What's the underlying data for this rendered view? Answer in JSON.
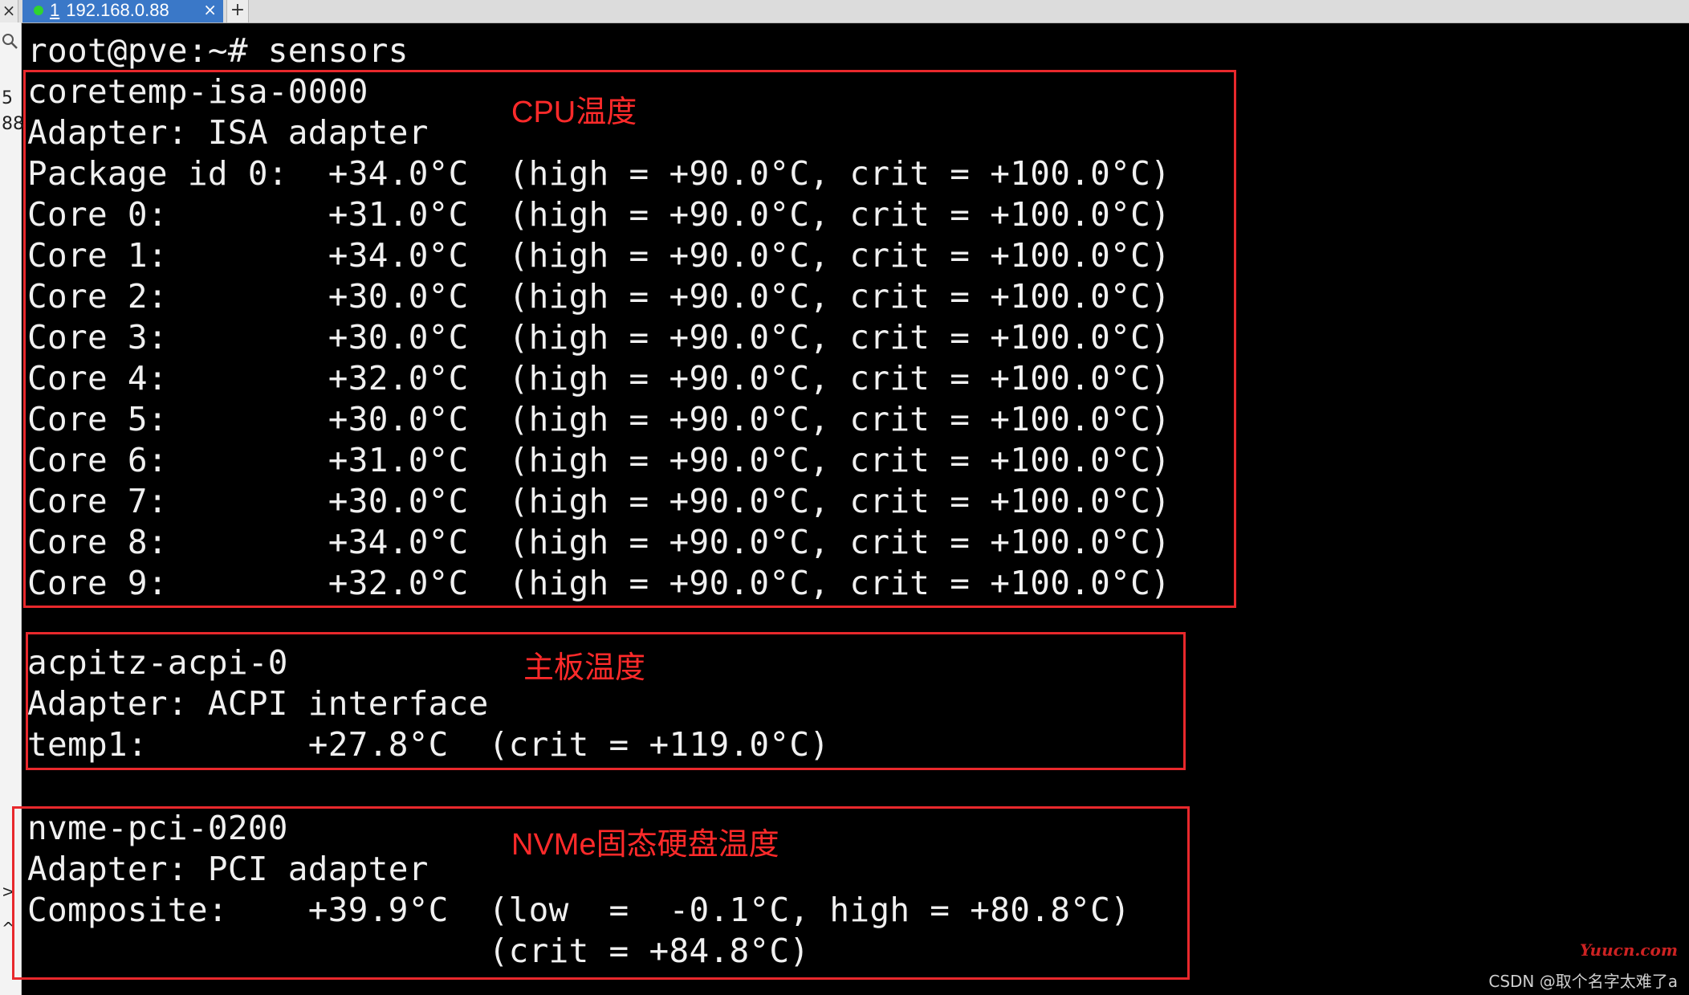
{
  "tabbar": {
    "close_all": "×",
    "active_tab": {
      "index": "1",
      "title": "192.168.0.88",
      "close": "×",
      "status_color": "#2fd42f"
    },
    "new_tab": "+"
  },
  "left_strip": [
    "5",
    "88",
    ">",
    "^"
  ],
  "terminal": {
    "lines": [
      "root@pve:~# sensors",
      "coretemp-isa-0000",
      "Adapter: ISA adapter",
      "Package id 0:  +34.0°C  (high = +90.0°C, crit = +100.0°C)",
      "Core 0:        +31.0°C  (high = +90.0°C, crit = +100.0°C)",
      "Core 1:        +34.0°C  (high = +90.0°C, crit = +100.0°C)",
      "Core 2:        +30.0°C  (high = +90.0°C, crit = +100.0°C)",
      "Core 3:        +30.0°C  (high = +90.0°C, crit = +100.0°C)",
      "Core 4:        +32.0°C  (high = +90.0°C, crit = +100.0°C)",
      "Core 5:        +30.0°C  (high = +90.0°C, crit = +100.0°C)",
      "Core 6:        +31.0°C  (high = +90.0°C, crit = +100.0°C)",
      "Core 7:        +30.0°C  (high = +90.0°C, crit = +100.0°C)",
      "Core 8:        +34.0°C  (high = +90.0°C, crit = +100.0°C)",
      "Core 9:        +32.0°C  (high = +90.0°C, crit = +100.0°C)",
      "",
      "acpitz-acpi-0",
      "Adapter: ACPI interface",
      "temp1:        +27.8°C  (crit = +119.0°C)",
      "",
      "nvme-pci-0200",
      "Adapter: PCI adapter",
      "Composite:    +39.9°C  (low  =  -0.1°C, high = +80.8°C)",
      "                       (crit = +84.8°C)"
    ]
  },
  "annotations": {
    "cpu": "CPU温度",
    "motherboard": "主板温度",
    "nvme": "NVMe固态硬盘温度"
  },
  "colors": {
    "annotation": "#e8282c",
    "terminal_bg": "#000000",
    "terminal_fg": "#f0f0f0",
    "tab_active": "#3a78c8"
  },
  "watermark": {
    "site": "Yuucn.com",
    "author": "CSDN @取个名字太难了a"
  }
}
